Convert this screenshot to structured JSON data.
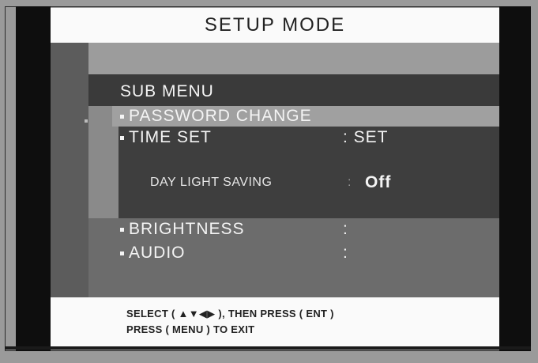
{
  "header": {
    "title": "SETUP MODE"
  },
  "menu": {
    "heading": "SUB MENU",
    "items": [
      {
        "label": "PASSWORD CHANGE",
        "value": ""
      },
      {
        "label": "TIME SET",
        "value": ": SET"
      },
      {
        "label": "BRIGHTNESS",
        "value": ":"
      },
      {
        "label": "AUDIO",
        "value": ":"
      }
    ],
    "sub_item": {
      "label": "DAY LIGHT SAVING",
      "separator": ":",
      "value": "Off"
    }
  },
  "footer": {
    "line1": "SELECT ( ▲▼◀▶ ), THEN PRESS ( ENT )",
    "line2": "PRESS ( MENU ) TO EXIT"
  }
}
